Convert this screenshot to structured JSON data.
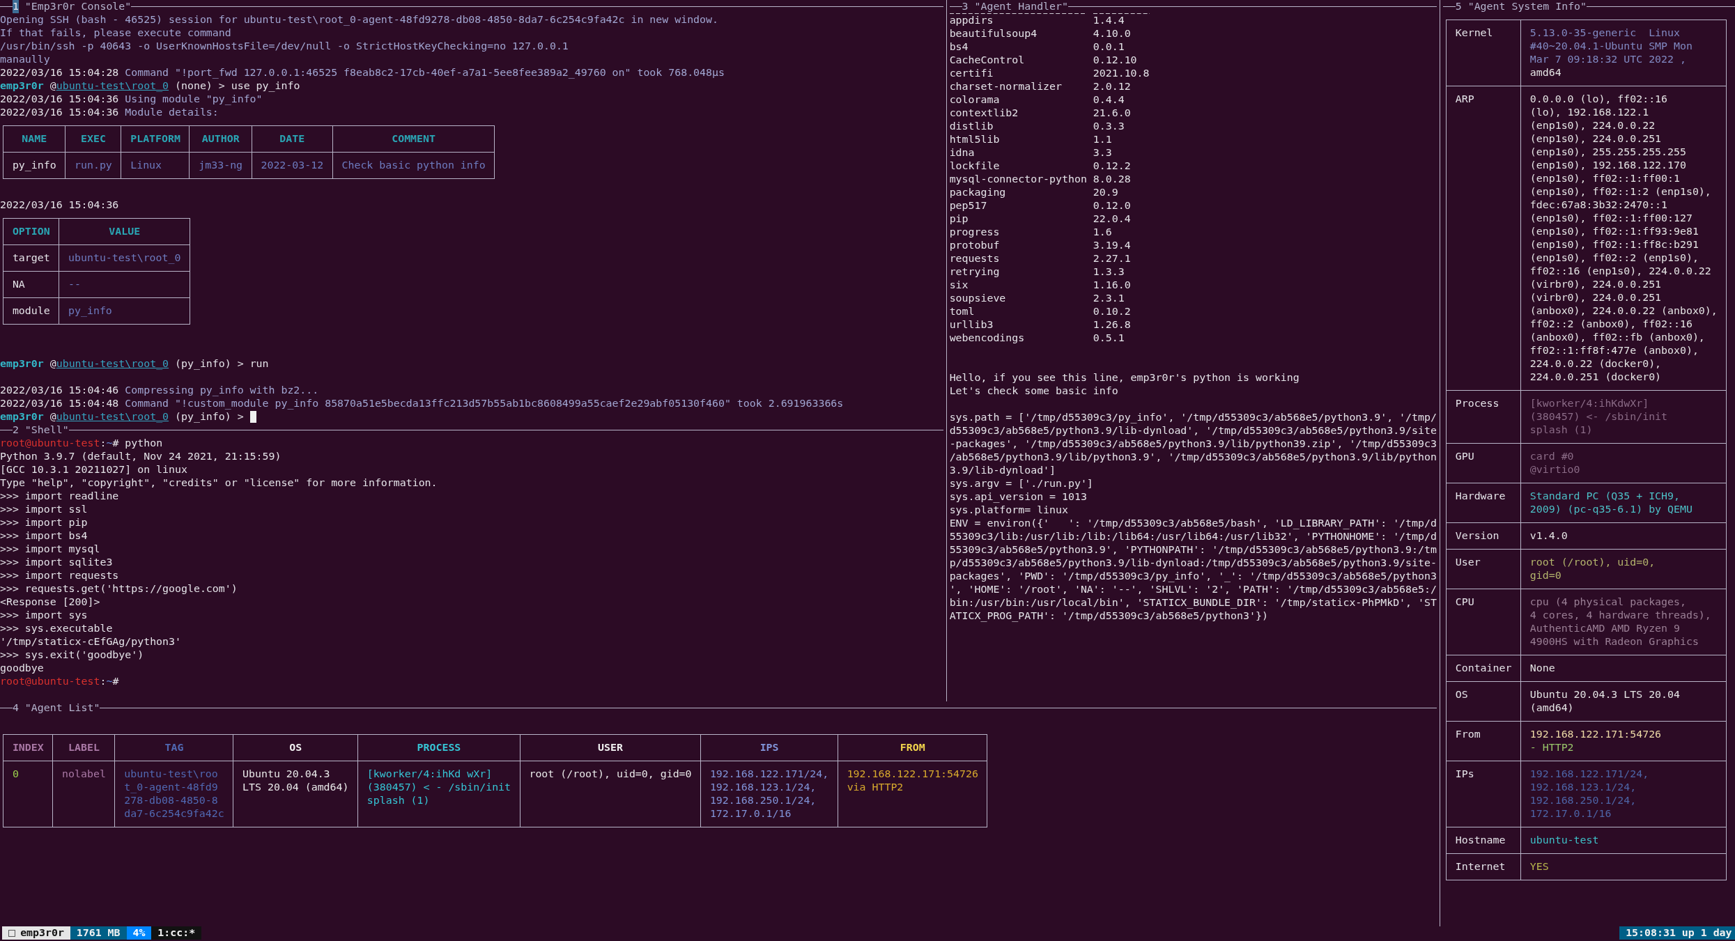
{
  "console": {
    "index": "1",
    "title": "\"Emp3r0r Console\"",
    "active": true,
    "blocks": [
      {
        "kind": "text",
        "text": "Opening SSH (bash - 46525) session for ubuntu-test\\root_0-agent-48fd9278-db08-4850-8da7-6c254c9fa42c in new window."
      },
      {
        "kind": "text",
        "text": "If that fails, please execute command"
      },
      {
        "kind": "text",
        "text": "/usr/bin/ssh -p 40643 -o UserKnownHostsFile=/dev/null -o StrictHostKeyChecking=no 127.0.0.1"
      },
      {
        "kind": "text",
        "text": "manaully"
      },
      {
        "kind": "log",
        "time": "2022/03/16 15:04:28",
        "text": "Command \"!port_fwd 127.0.0.1:46525 f8eab8c2-17cb-40ef-a7a1-5ee8fee389a2_49760 on\" took 768.048µs"
      },
      {
        "kind": "prompt",
        "user": "emp3r0r",
        "at": "@",
        "target": "ubuntu-test\\root_0",
        "rest": "(none) > use py_info",
        "cursor": false
      },
      {
        "kind": "log",
        "time": "2022/03/16 15:04:36",
        "text": "Using module \"py_info\""
      },
      {
        "kind": "log",
        "time": "2022/03/16 15:04:36",
        "text": "Module details:"
      },
      {
        "kind": "table",
        "columns": [
          "NAME",
          "EXEC",
          "PLATFORM",
          "AUTHOR",
          "DATE",
          "COMMENT"
        ],
        "rows": [
          [
            "py_info",
            "run.py",
            "Linux",
            "jm33-ng",
            "2022-03-12",
            "Check basic python info"
          ]
        ]
      },
      {
        "kind": "blank"
      },
      {
        "kind": "log",
        "time": "2022/03/16 15:04:36"
      },
      {
        "kind": "table",
        "columns": [
          "OPTION",
          "VALUE"
        ],
        "rows": [
          [
            "target",
            "ubuntu-test\\root_0"
          ],
          [
            "NA",
            "--"
          ],
          [
            "module",
            "py_info"
          ]
        ]
      },
      {
        "kind": "blank"
      },
      {
        "kind": "blank"
      },
      {
        "kind": "prompt",
        "user": "emp3r0r",
        "at": "@",
        "target": "ubuntu-test\\root_0",
        "rest": "(py_info) > run",
        "cursor": false
      },
      {
        "kind": "blank"
      },
      {
        "kind": "log",
        "time": "2022/03/16 15:04:46",
        "text": "Compressing py_info with bz2..."
      },
      {
        "kind": "log",
        "time": "2022/03/16 15:04:48",
        "text": "Command \"!custom_module py_info 85870a51e5becda13ffc213d57b55ab1bc8608499a55caef2e29abf05130f460\" took 2.691963366s"
      },
      {
        "kind": "prompt",
        "user": "emp3r0r",
        "at": "@",
        "target": "ubuntu-test\\root_0",
        "rest": "(py_info) >",
        "cursor": true
      }
    ]
  },
  "shell": {
    "index": "2",
    "title": "\"Shell\"",
    "active": false,
    "blocks": [
      {
        "kind": "shell_prompt",
        "user_host": "root@ubuntu-test",
        "sep": ":",
        "dir": "~",
        "sign": "#",
        "command": "python"
      },
      {
        "kind": "text",
        "text": "Python 3.9.7 (default, Nov 24 2021, 21:15:59)"
      },
      {
        "kind": "text",
        "text": "[GCC 10.3.1 20211027] on linux"
      },
      {
        "kind": "text",
        "text": "Type \"help\", \"copyright\", \"credits\" or \"license\" for more information."
      },
      {
        "kind": "text",
        "text": ">>> import readline"
      },
      {
        "kind": "text",
        "text": ">>> import ssl"
      },
      {
        "kind": "text",
        "text": ">>> import pip"
      },
      {
        "kind": "text",
        "text": ">>> import bs4"
      },
      {
        "kind": "text",
        "text": ">>> import mysql"
      },
      {
        "kind": "text",
        "text": ">>> import sqlite3"
      },
      {
        "kind": "text",
        "text": ">>> import requests"
      },
      {
        "kind": "text",
        "text": ">>> requests.get('https://google.com')"
      },
      {
        "kind": "text",
        "text": "<Response [200]>"
      },
      {
        "kind": "text",
        "text": ">>> import sys"
      },
      {
        "kind": "text",
        "text": ">>> sys.executable"
      },
      {
        "kind": "text",
        "text": "'/tmp/staticx-cEfGAg/python3'"
      },
      {
        "kind": "text",
        "text": ">>> sys.exit('goodbye')"
      },
      {
        "kind": "text",
        "text": "goodbye"
      },
      {
        "kind": "shell_prompt",
        "user_host": "root@ubuntu-test",
        "sep": ":",
        "dir": "~",
        "sign": "#"
      }
    ]
  },
  "agent_handler": {
    "index": "3",
    "title": "\"Agent Handler\"",
    "active": false,
    "packages": [
      {
        "name": "appdirs",
        "version": "1.4.4"
      },
      {
        "name": "beautifulsoup4",
        "version": "4.10.0"
      },
      {
        "name": "bs4",
        "version": "0.0.1"
      },
      {
        "name": "CacheControl",
        "version": "0.12.10"
      },
      {
        "name": "certifi",
        "version": "2021.10.8"
      },
      {
        "name": "charset-normalizer",
        "version": "2.0.12"
      },
      {
        "name": "colorama",
        "version": "0.4.4"
      },
      {
        "name": "contextlib2",
        "version": "21.6.0"
      },
      {
        "name": "distlib",
        "version": "0.3.3"
      },
      {
        "name": "html5lib",
        "version": "1.1"
      },
      {
        "name": "idna",
        "version": "3.3"
      },
      {
        "name": "lockfile",
        "version": "0.12.2"
      },
      {
        "name": "mysql-connector-python",
        "version": "8.0.28"
      },
      {
        "name": "packaging",
        "version": "20.9"
      },
      {
        "name": "pep517",
        "version": "0.12.0"
      },
      {
        "name": "pip",
        "version": "22.0.4"
      },
      {
        "name": "progress",
        "version": "1.6"
      },
      {
        "name": "protobuf",
        "version": "3.19.4"
      },
      {
        "name": "requests",
        "version": "2.27.1"
      },
      {
        "name": "retrying",
        "version": "1.3.3"
      },
      {
        "name": "six",
        "version": "1.16.0"
      },
      {
        "name": "soupsieve",
        "version": "2.3.1"
      },
      {
        "name": "toml",
        "version": "0.10.2"
      },
      {
        "name": "urllib3",
        "version": "1.26.8"
      },
      {
        "name": "webencodings",
        "version": "0.5.1"
      }
    ],
    "blocks": [
      {
        "kind": "blank"
      },
      {
        "kind": "blank"
      },
      {
        "kind": "text",
        "text": "Hello, if you see this line, emp3r0r's python is working"
      },
      {
        "kind": "text",
        "text": "Let's check some basic info"
      },
      {
        "kind": "blank"
      },
      {
        "kind": "text",
        "text": "sys.path = ['/tmp/d55309c3/py_info', '/tmp/d55309c3/ab568e5/python3.9', '/tmp/"
      },
      {
        "kind": "text",
        "text": "d55309c3/ab568e5/python3.9/lib-dynload', '/tmp/d55309c3/ab568e5/python3.9/site"
      },
      {
        "kind": "text",
        "text": "-packages', '/tmp/d55309c3/ab568e5/python3.9/lib/python39.zip', '/tmp/d55309c3"
      },
      {
        "kind": "text",
        "text": "/ab568e5/python3.9/lib/python3.9', '/tmp/d55309c3/ab568e5/python3.9/lib/python"
      },
      {
        "kind": "text",
        "text": "3.9/lib-dynload']"
      },
      {
        "kind": "text",
        "text": "sys.argv = ['./run.py']"
      },
      {
        "kind": "text",
        "text": "sys.api_version = 1013"
      },
      {
        "kind": "text",
        "text": "sys.platform= linux"
      },
      {
        "kind": "text",
        "text": "ENV = environ({'   ': '/tmp/d55309c3/ab568e5/bash', 'LD_LIBRARY_PATH': '/tmp/d"
      },
      {
        "kind": "text",
        "text": "55309c3/lib:/usr/lib:/lib:/lib64:/usr/lib64:/usr/lib32', 'PYTHONHOME': '/tmp/d"
      },
      {
        "kind": "text",
        "text": "55309c3/ab568e5/python3.9', 'PYTHONPATH': '/tmp/d55309c3/ab568e5/python3.9:/tm"
      },
      {
        "kind": "text",
        "text": "p/d55309c3/ab568e5/python3.9/lib-dynload:/tmp/d55309c3/ab568e5/python3.9/site-"
      },
      {
        "kind": "text",
        "text": "packages', 'PWD': '/tmp/d55309c3/py_info', '_': '/tmp/d55309c3/ab568e5/python3"
      },
      {
        "kind": "text",
        "text": "', 'HOME': '/root', 'NA': '--', 'SHLVL': '2', 'PATH': '/tmp/d55309c3/ab568e5:/"
      },
      {
        "kind": "text",
        "text": "bin:/usr/bin:/usr/local/bin', 'STATICX_BUNDLE_DIR': '/tmp/staticx-PhPMkD', 'ST"
      },
      {
        "kind": "text",
        "text": "ATICX_PROG_PATH': '/tmp/d55309c3/ab568e5/python3'})"
      }
    ]
  },
  "agent_list": {
    "index": "4",
    "title": "\"Agent List\"",
    "active": false,
    "columns": [
      {
        "label": "INDEX",
        "color": "#a978a5"
      },
      {
        "label": "LABEL",
        "color": "#a978a5"
      },
      {
        "label": "TAG",
        "color": "#5068b2"
      },
      {
        "label": "OS",
        "color": "#f0f0f0"
      },
      {
        "label": "PROCESS",
        "color": "#36c5d5"
      },
      {
        "label": "USER",
        "color": "#f0f0f0"
      },
      {
        "label": "IPS",
        "color": "#8093d8"
      },
      {
        "label": "FROM",
        "color": "#f2d54c"
      }
    ],
    "rows": [
      {
        "cells": [
          {
            "lines": [
              "0"
            ],
            "color": "#9bd24b"
          },
          {
            "lines": [
              "nolabel"
            ],
            "color": "#a978a5"
          },
          {
            "lines": [
              "ubuntu-test\\roo",
              "t_0-agent-48fd9",
              "278-db08-4850-8",
              "da7-6c254c9fa42c"
            ],
            "color": "#5068b2"
          },
          {
            "lines": [
              "Ubuntu 20.04.3",
              "LTS 20.04 (amd64)"
            ],
            "color": "#e8e8e8"
          },
          {
            "lines": [
              "[kworker/4:ihKd wXr]",
              "(380457) < - /sbin/init",
              "splash (1)"
            ],
            "color": "#36c5d5"
          },
          {
            "lines": [
              "root (/root), uid=0, gid=0"
            ],
            "color": "#e8e8e8"
          },
          {
            "lines": [
              "192.168.122.171/24,",
              "192.168.123.1/24,",
              "192.168.250.1/24,",
              "172.17.0.1/16"
            ],
            "color": "#8093d8"
          },
          {
            "lines": [
              "192.168.122.171:54726",
              "via HTTP2"
            ],
            "color": "#d7a92d"
          }
        ]
      }
    ]
  },
  "agent_system_info": {
    "index": "5",
    "title": "\"Agent System Info\"",
    "active": false,
    "rows": [
      {
        "label": "Kernel",
        "values": [
          {
            "lines": [
              "5.13.0-35-generic  Linux",
              "#40~20.04.1-Ubuntu SMP Mon",
              "Mar 7 09:18:32 UTC 2022 ,"
            ],
            "color": "#8089c2"
          },
          {
            "lines": [
              "amd64"
            ],
            "color": "#e4e4e4"
          }
        ]
      },
      {
        "label": "ARP",
        "values": [
          {
            "lines": [
              "0.0.0.0 (lo), ff02::16",
              "(lo), 192.168.122.1",
              "(enp1s0), 224.0.0.22",
              "(enp1s0), 224.0.0.251",
              "(enp1s0), 255.255.255.255",
              "(enp1s0), 192.168.122.170",
              "(enp1s0), ff02::1:ff00:1",
              "(enp1s0), ff02::1:2 (enp1s0),",
              "fdec:67a8:3b32:2470::1",
              "(enp1s0), ff02::1:ff00:127",
              "(enp1s0), ff02::1:ff93:9e81",
              "(enp1s0), ff02::1:ff8c:b291",
              "(enp1s0), ff02::2 (enp1s0),",
              "ff02::16 (enp1s0), 224.0.0.22",
              "(virbr0), 224.0.0.251",
              "(virbr0), 224.0.0.251",
              "(anbox0), 224.0.0.22 (anbox0),",
              "ff02::2 (anbox0), ff02::16",
              "(anbox0), ff02::fb (anbox0),",
              "ff02::1:ff8f:477e (anbox0),",
              "224.0.0.22 (docker0),",
              "224.0.0.251 (docker0)"
            ],
            "color": "#e4e4e4"
          }
        ]
      },
      {
        "label": "Process",
        "values": [
          {
            "lines": [
              "[kworker/4:ihKdwXr]",
              "(380457) <- /sbin/init",
              "splash (1)"
            ],
            "color": "#8a6b86"
          }
        ]
      },
      {
        "label": "GPU",
        "values": [
          {
            "lines": [
              "card #0",
              "@virtio0"
            ],
            "color": "#8a6b86"
          }
        ]
      },
      {
        "label": "Hardware",
        "values": [
          {
            "lines": [
              "Standard PC (Q35 + ICH9,",
              "2009) (pc-q35-6.1) by QEMU"
            ],
            "color": "#4cbfc6"
          }
        ]
      },
      {
        "label": "Version",
        "values": [
          {
            "lines": [
              "v1.4.0"
            ],
            "color": "#e4e4e4"
          }
        ]
      },
      {
        "label": "User",
        "values": [
          {
            "lines": [
              "root (/root), uid=0,",
              "gid=0"
            ],
            "color": "#b3b46c"
          }
        ]
      },
      {
        "label": "CPU",
        "values": [
          {
            "lines": [
              "cpu (4 physical packages,",
              "4 cores, 4 hardware threads),",
              "AuthenticAMD AMD Ryzen 9",
              "4900HS with Radeon Graphics"
            ],
            "color": "#9a7f95"
          }
        ]
      },
      {
        "label": "Container",
        "values": [
          {
            "lines": [
              "None"
            ],
            "color": "#e4e4e4"
          }
        ]
      },
      {
        "label": "OS",
        "values": [
          {
            "lines": [
              "Ubuntu 20.04.3 LTS 20.04",
              "(amd64)"
            ],
            "color": "#e4e4e4"
          }
        ]
      },
      {
        "label": "From",
        "values": [
          {
            "lines": [
              "192.168.122.171:54726"
            ],
            "color": "#ecd9a6"
          },
          {
            "lines": [
              "- HTTP2"
            ],
            "color": "#98c46a"
          }
        ]
      },
      {
        "label": "IPs",
        "values": [
          {
            "lines": [
              "192.168.122.171/24,",
              "192.168.123.1/24,",
              "192.168.250.1/24,",
              "172.17.0.1/16"
            ],
            "color": "#4d64a6"
          }
        ]
      },
      {
        "label": "Hostname",
        "values": [
          {
            "lines": [
              "ubuntu-test"
            ],
            "color": "#3ec1c8"
          }
        ]
      },
      {
        "label": "Internet",
        "values": [
          {
            "lines": [
              "YES"
            ],
            "color": "#b9b84c"
          }
        ]
      }
    ]
  },
  "status_bar": {
    "segments": [
      {
        "kind": "session",
        "text": "emp3r0r"
      },
      {
        "kind": "memory",
        "text": "1761 MB"
      },
      {
        "kind": "cpu",
        "text": "4%"
      },
      {
        "kind": "window",
        "text": "1:cc:*"
      }
    ],
    "uptime": "15:08:31 up 1 day"
  }
}
